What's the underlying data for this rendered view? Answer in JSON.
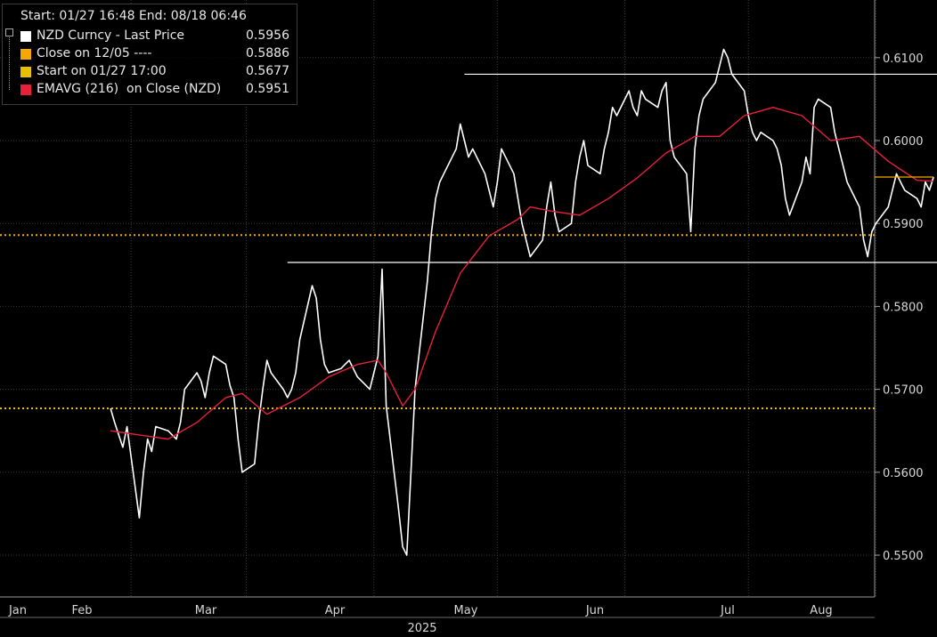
{
  "legend": {
    "header": "Start: 01/27 16:48 End: 08/18 06:46",
    "items": [
      {
        "name": "NZD Curncy - Last Price",
        "value": "0.5956",
        "color": "#ffffff"
      },
      {
        "name": "Close on 12/05 ----",
        "value": "0.5886",
        "color": "#f5a800"
      },
      {
        "name": "Start on 01/27 17:00",
        "value": "0.5677",
        "color": "#e6c000"
      },
      {
        "name": "EMAVG (216)  on Close (NZD)",
        "value": "0.5951",
        "color": "#e8203a"
      }
    ]
  },
  "chart_data": {
    "type": "line",
    "ylim": [
      0.5445,
      0.6125
    ],
    "yticks": [
      "0.5500",
      "0.5600",
      "0.5700",
      "0.5800",
      "0.5900",
      "0.6000",
      "0.6100"
    ],
    "xlabels": [
      "Jan",
      "Feb",
      "Mar",
      "Apr",
      "May",
      "Jun",
      "Jul",
      "Aug"
    ],
    "year_label": "2025",
    "grid": true,
    "series": [
      {
        "name": "NZD Curncy - Last Price",
        "color": "#ffffff",
        "points": [
          [
            "01-27",
            0.5677
          ],
          [
            "01-28",
            0.566
          ],
          [
            "01-29",
            0.5645
          ],
          [
            "01-30",
            0.563
          ],
          [
            "01-31",
            0.5655
          ],
          [
            "02-03",
            0.5545
          ],
          [
            "02-04",
            0.56
          ],
          [
            "02-05",
            0.564
          ],
          [
            "02-06",
            0.5625
          ],
          [
            "02-07",
            0.5655
          ],
          [
            "02-10",
            0.565
          ],
          [
            "02-11",
            0.5645
          ],
          [
            "02-12",
            0.564
          ],
          [
            "02-13",
            0.566
          ],
          [
            "02-14",
            0.57
          ],
          [
            "02-17",
            0.572
          ],
          [
            "02-18",
            0.571
          ],
          [
            "02-19",
            0.569
          ],
          [
            "02-20",
            0.572
          ],
          [
            "02-21",
            0.574
          ],
          [
            "02-24",
            0.573
          ],
          [
            "02-25",
            0.5705
          ],
          [
            "02-26",
            0.569
          ],
          [
            "02-27",
            0.564
          ],
          [
            "02-28",
            0.56
          ],
          [
            "03-03",
            0.561
          ],
          [
            "03-04",
            0.566
          ],
          [
            "03-05",
            0.57
          ],
          [
            "03-06",
            0.5735
          ],
          [
            "03-07",
            0.572
          ],
          [
            "03-10",
            0.57
          ],
          [
            "03-11",
            0.569
          ],
          [
            "03-12",
            0.57
          ],
          [
            "03-13",
            0.572
          ],
          [
            "03-14",
            0.576
          ],
          [
            "03-17",
            0.5825
          ],
          [
            "03-18",
            0.581
          ],
          [
            "03-19",
            0.576
          ],
          [
            "03-20",
            0.573
          ],
          [
            "03-21",
            0.572
          ],
          [
            "03-24",
            0.5725
          ],
          [
            "03-25",
            0.573
          ],
          [
            "03-26",
            0.5735
          ],
          [
            "03-27",
            0.5725
          ],
          [
            "03-28",
            0.5715
          ],
          [
            "03-31",
            0.57
          ],
          [
            "04-01",
            0.572
          ],
          [
            "04-02",
            0.574
          ],
          [
            "04-03",
            0.5845
          ],
          [
            "04-04",
            0.568
          ],
          [
            "04-07",
            0.5555
          ],
          [
            "04-08",
            0.551
          ],
          [
            "04-09",
            0.55
          ],
          [
            "04-10",
            0.56
          ],
          [
            "04-11",
            0.57
          ],
          [
            "04-14",
            0.583
          ],
          [
            "04-15",
            0.589
          ],
          [
            "04-16",
            0.593
          ],
          [
            "04-17",
            0.595
          ],
          [
            "04-18",
            0.596
          ],
          [
            "04-21",
            0.599
          ],
          [
            "04-22",
            0.602
          ],
          [
            "04-23",
            0.6
          ],
          [
            "04-24",
            0.598
          ],
          [
            "04-25",
            0.599
          ],
          [
            "04-28",
            0.596
          ],
          [
            "04-29",
            0.594
          ],
          [
            "04-30",
            0.592
          ],
          [
            "05-01",
            0.595
          ],
          [
            "05-02",
            0.599
          ],
          [
            "05-05",
            0.596
          ],
          [
            "05-06",
            0.593
          ],
          [
            "05-07",
            0.59
          ],
          [
            "05-08",
            0.588
          ],
          [
            "05-09",
            0.586
          ],
          [
            "05-12",
            0.588
          ],
          [
            "05-13",
            0.592
          ],
          [
            "05-14",
            0.595
          ],
          [
            "05-15",
            0.591
          ],
          [
            "05-16",
            0.589
          ],
          [
            "05-19",
            0.59
          ],
          [
            "05-20",
            0.595
          ],
          [
            "05-21",
            0.598
          ],
          [
            "05-22",
            0.6
          ],
          [
            "05-23",
            0.597
          ],
          [
            "05-26",
            0.596
          ],
          [
            "05-27",
            0.599
          ],
          [
            "05-28",
            0.601
          ],
          [
            "05-29",
            0.604
          ],
          [
            "05-30",
            0.603
          ],
          [
            "06-02",
            0.606
          ],
          [
            "06-03",
            0.604
          ],
          [
            "06-04",
            0.603
          ],
          [
            "06-05",
            0.606
          ],
          [
            "06-06",
            0.605
          ],
          [
            "06-09",
            0.604
          ],
          [
            "06-10",
            0.606
          ],
          [
            "06-11",
            0.607
          ],
          [
            "06-12",
            0.6
          ],
          [
            "06-13",
            0.598
          ],
          [
            "06-16",
            0.596
          ],
          [
            "06-17",
            0.589
          ],
          [
            "06-18",
            0.599
          ],
          [
            "06-19",
            0.603
          ],
          [
            "06-20",
            0.605
          ],
          [
            "06-23",
            0.607
          ],
          [
            "06-24",
            0.609
          ],
          [
            "06-25",
            0.611
          ],
          [
            "06-26",
            0.61
          ],
          [
            "06-27",
            0.608
          ],
          [
            "06-30",
            0.606
          ],
          [
            "07-01",
            0.603
          ],
          [
            "07-02",
            0.601
          ],
          [
            "07-03",
            0.6
          ],
          [
            "07-04",
            0.601
          ],
          [
            "07-07",
            0.6
          ],
          [
            "07-08",
            0.599
          ],
          [
            "07-09",
            0.597
          ],
          [
            "07-10",
            0.593
          ],
          [
            "07-11",
            0.591
          ],
          [
            "07-14",
            0.595
          ],
          [
            "07-15",
            0.598
          ],
          [
            "07-16",
            0.596
          ],
          [
            "07-17",
            0.604
          ],
          [
            "07-18",
            0.605
          ],
          [
            "07-21",
            0.604
          ],
          [
            "07-22",
            0.601
          ],
          [
            "07-23",
            0.599
          ],
          [
            "07-24",
            0.597
          ],
          [
            "07-25",
            0.595
          ],
          [
            "07-28",
            0.592
          ],
          [
            "07-29",
            0.588
          ],
          [
            "07-30",
            0.586
          ],
          [
            "07-31",
            0.589
          ],
          [
            "08-01",
            0.59
          ],
          [
            "08-04",
            0.592
          ],
          [
            "08-05",
            0.594
          ],
          [
            "08-06",
            0.596
          ],
          [
            "08-07",
            0.595
          ],
          [
            "08-08",
            0.594
          ],
          [
            "08-11",
            0.593
          ],
          [
            "08-12",
            0.592
          ],
          [
            "08-13",
            0.595
          ],
          [
            "08-14",
            0.594
          ],
          [
            "08-15",
            0.5956
          ]
        ]
      },
      {
        "name": "EMAVG (216)  on Close (NZD)",
        "color": "#e8203a",
        "points": [
          [
            "01-27",
            0.565
          ],
          [
            "02-03",
            0.5645
          ],
          [
            "02-10",
            0.564
          ],
          [
            "02-17",
            0.566
          ],
          [
            "02-24",
            0.569
          ],
          [
            "02-28",
            0.5695
          ],
          [
            "03-06",
            0.567
          ],
          [
            "03-14",
            0.569
          ],
          [
            "03-21",
            0.5715
          ],
          [
            "03-28",
            0.573
          ],
          [
            "04-02",
            0.5735
          ],
          [
            "04-04",
            0.572
          ],
          [
            "04-08",
            0.568
          ],
          [
            "04-11",
            0.57
          ],
          [
            "04-16",
            0.577
          ],
          [
            "04-22",
            0.584
          ],
          [
            "04-29",
            0.5885
          ],
          [
            "05-06",
            0.5905
          ],
          [
            "05-09",
            0.592
          ],
          [
            "05-14",
            0.5915
          ],
          [
            "05-21",
            0.591
          ],
          [
            "05-28",
            0.593
          ],
          [
            "06-04",
            0.5955
          ],
          [
            "06-11",
            0.5985
          ],
          [
            "06-18",
            0.6005
          ],
          [
            "06-24",
            0.6005
          ],
          [
            "06-30",
            0.603
          ],
          [
            "07-07",
            0.604
          ],
          [
            "07-14",
            0.603
          ],
          [
            "07-21",
            0.6
          ],
          [
            "07-28",
            0.6005
          ],
          [
            "08-04",
            0.5975
          ],
          [
            "08-11",
            0.5952
          ],
          [
            "08-15",
            0.5951
          ]
        ]
      }
    ],
    "reference_lines": [
      {
        "label": "Close on 12/05",
        "value": 0.5886,
        "color": "#f5a800",
        "style": "dotted"
      },
      {
        "label": "Start on 01/27 17:00",
        "value": 0.5677,
        "color": "#e6c000",
        "style": "dotted"
      },
      {
        "value": 0.608,
        "color": "#ffffff",
        "style": "solid",
        "from": "04-23",
        "to": "08-29"
      },
      {
        "value": 0.5853,
        "color": "#ffffff",
        "style": "solid",
        "from": "03-11",
        "to": "08-29"
      }
    ],
    "last_price_marker": {
      "value": 0.5956,
      "color": "#f5a800"
    }
  }
}
